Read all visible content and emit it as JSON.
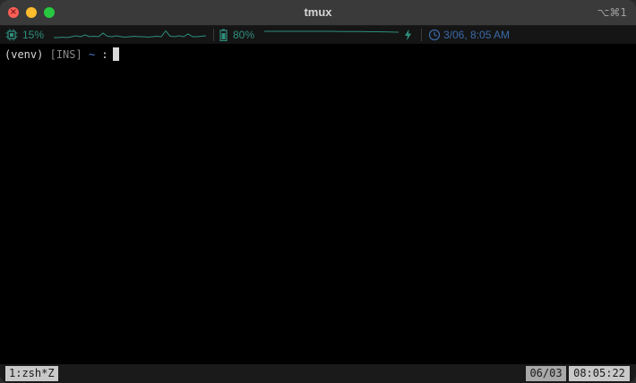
{
  "window": {
    "title": "tmux",
    "shortcut": "⌥⌘1"
  },
  "status": {
    "cpu": {
      "icon": "cpu-icon",
      "value": "15%",
      "spark": [
        0.2,
        0.2,
        0.25,
        0.2,
        0.3,
        0.4,
        0.3,
        0.5,
        0.3,
        0.35,
        0.3,
        0.7,
        0.35,
        0.3,
        0.4,
        0.3,
        0.25,
        0.3,
        0.35,
        0.3,
        0.3,
        0.25,
        0.3,
        0.35,
        0.3,
        0.95,
        0.35,
        0.3,
        0.4,
        0.3,
        0.6,
        0.3,
        0.3,
        0.35,
        0.4
      ]
    },
    "battery": {
      "icon": "battery-icon",
      "value": "80%",
      "spark": [
        0.9,
        0.9,
        0.9,
        0.9,
        0.9,
        0.9,
        0.9,
        0.9,
        0.88,
        0.88,
        0.88,
        0.85,
        0.85,
        0.82,
        0.8
      ],
      "charging_icon": "lightning-icon"
    },
    "clock": {
      "icon": "clock-icon",
      "value": "3/06, 8:05 AM"
    },
    "colors": {
      "accent": "#2e8f7e",
      "clock": "#3a6aa8"
    }
  },
  "terminal": {
    "venv": "(venv)",
    "mode": "[INS]",
    "cwd": "~",
    "separator": ":"
  },
  "tmux": {
    "window_tab": "1:zsh*Z",
    "date": "06/03",
    "time": "08:05:22"
  }
}
